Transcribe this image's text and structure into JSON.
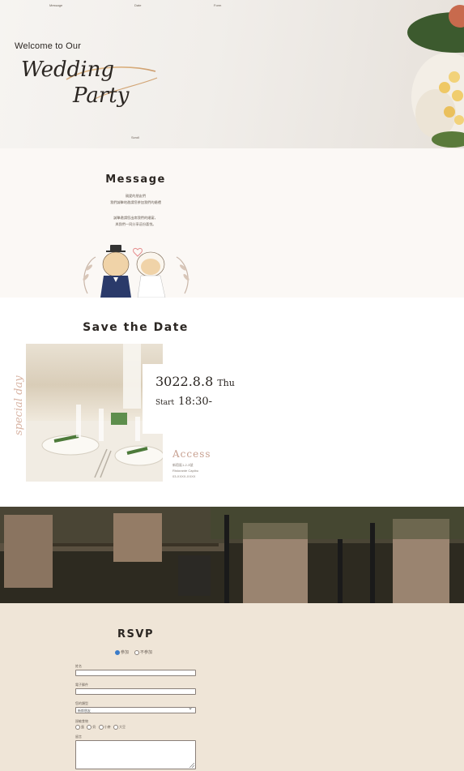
{
  "nav": {
    "items": [
      {
        "label": "Message"
      },
      {
        "label": "Date"
      },
      {
        "label": "Form"
      }
    ]
  },
  "hero": {
    "welcome": "Welcome to Our",
    "title_line1": "Wedding",
    "title_line2": "Party",
    "scroll": "Scroll"
  },
  "message": {
    "title": "Message",
    "lines": [
      "親愛的朋友們",
      "我們誠摯地邀請您參加我們的婚禮",
      "",
      "誠摯邀請您出席我們的婚宴，",
      "與我們一同分享這份喜悅。"
    ]
  },
  "save_the_date": {
    "title": "Save the Date",
    "special_day": "special day",
    "date": "3022.8.8",
    "weekday": "Thu",
    "start_label": "Start",
    "start_time": "18:30-",
    "access_title": "Access",
    "access_lines": [
      "新宿區1-2-3號",
      "Ristorante Capibu",
      "03-XXXX-XXXX"
    ]
  },
  "rsvp": {
    "title": "RSVP",
    "attend": "参加",
    "not_attend": "不参加",
    "name_label": "姓名",
    "phone_label": "電子郵件",
    "type_label": "您的類型",
    "type_value": "新郎朋友",
    "allergy_label": "過敏食物",
    "allergy_options": [
      "蛋",
      "奶",
      "小麥",
      "大豆"
    ],
    "note_label": "留言"
  },
  "colors": {
    "accent": "#c7a090",
    "rsvp_bg": "#efe5d7",
    "message_bg": "#fbf8f5"
  }
}
